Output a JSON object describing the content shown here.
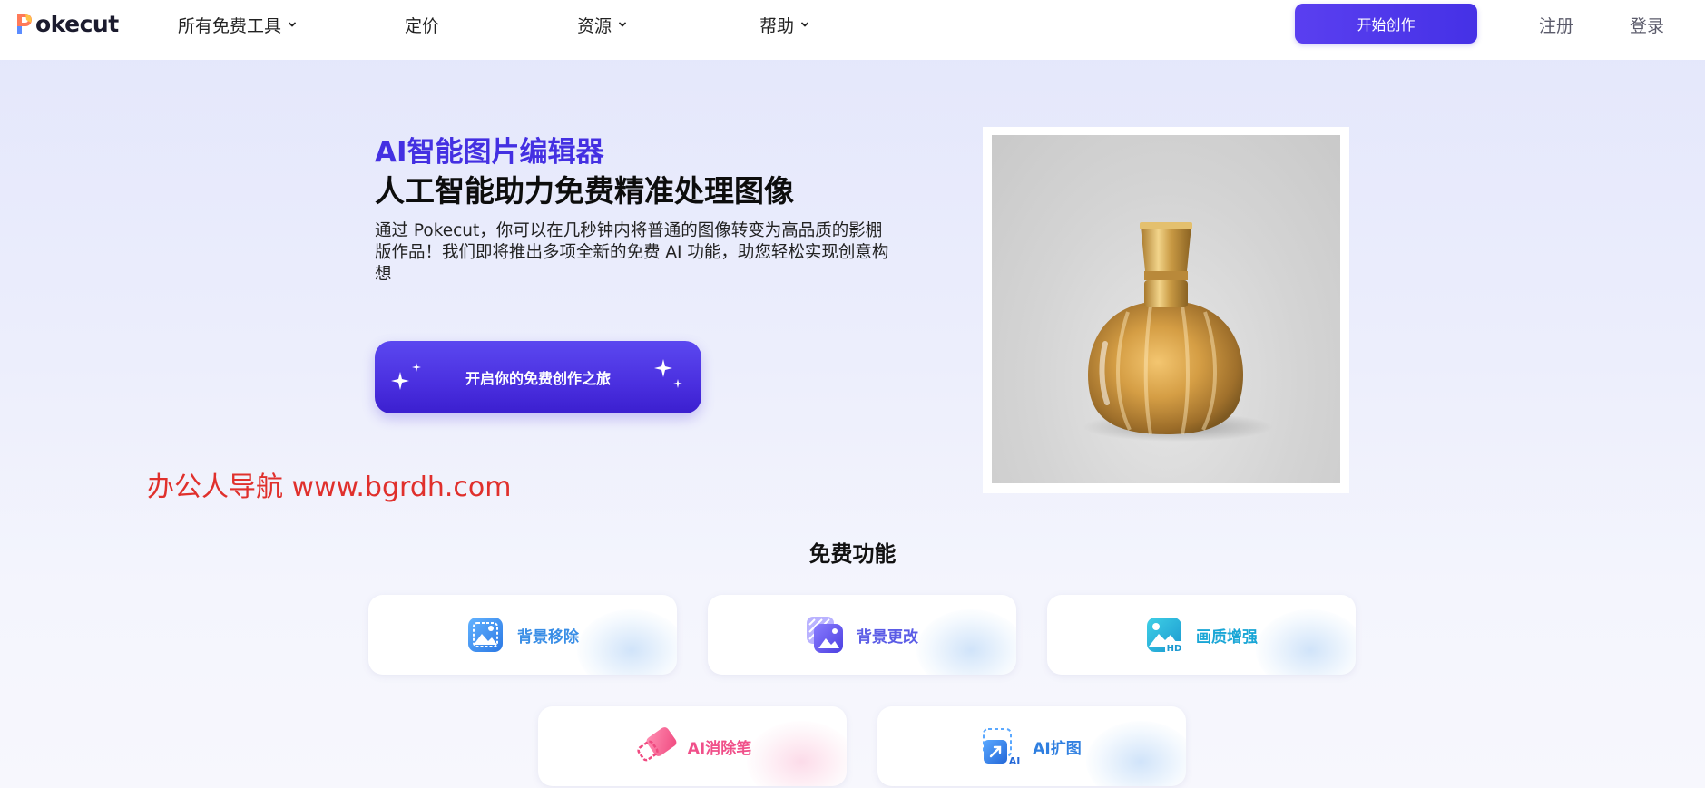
{
  "header": {
    "logo_text": "okecut",
    "logo_letter": "P",
    "nav": [
      {
        "label": "所有免费工具",
        "has_dropdown": true
      },
      {
        "label": "定价",
        "has_dropdown": false
      },
      {
        "label": "资源",
        "has_dropdown": true
      },
      {
        "label": "帮助",
        "has_dropdown": true
      }
    ],
    "start_button": "开始创作",
    "register": "注册",
    "login": "登录"
  },
  "hero": {
    "title_accent": "AI智能图片编辑器",
    "title_main": "人工智能助力免费精准处理图像",
    "description": "通过 Pokecut，你可以在几秒钟内将普通的图像转变为高品质的影棚版作品！我们即将推出多项全新的免费 AI 功能，助您轻松实现创意构想",
    "cta_label": "开启你的免费创作之旅"
  },
  "watermark": "办公人导航 www.bgrdh.com",
  "features": {
    "title": "免费功能",
    "items": [
      {
        "label": "背景移除",
        "icon": "image-remove-bg-icon",
        "color": "#3a8ee6"
      },
      {
        "label": "背景更改",
        "icon": "image-change-bg-icon",
        "color": "#5b5ce6"
      },
      {
        "label": "画质增强",
        "icon": "image-hd-icon",
        "color": "#1aa6d6"
      },
      {
        "label": "AI消除笔",
        "icon": "eraser-icon",
        "color": "#f0508a"
      },
      {
        "label": "AI扩图",
        "icon": "expand-image-icon",
        "color": "#2f7fe0"
      }
    ]
  },
  "colors": {
    "accent": "#4430e2",
    "watermark": "#e0302c"
  }
}
